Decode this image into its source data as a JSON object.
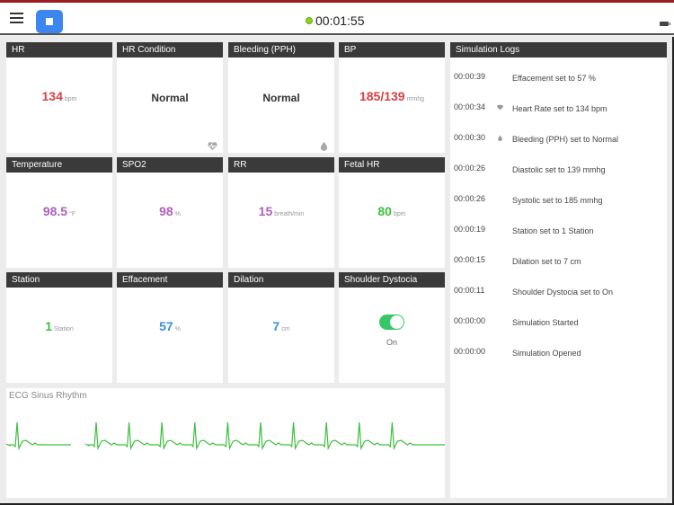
{
  "header": {
    "timer": "00:01:55",
    "status_color": "#8ed41c",
    "accent_color": "#3d86f0",
    "brand_bar_color": "#9b1c22"
  },
  "tiles": [
    {
      "id": "hr",
      "label": "HR",
      "value": "134",
      "unit": "bpm",
      "color": "red"
    },
    {
      "id": "hr-condition",
      "label": "HR Condition",
      "text": "Normal",
      "icon": "heart-pulse-icon"
    },
    {
      "id": "bleeding",
      "label": "Bleeding (PPH)",
      "text": "Normal",
      "icon": "drop-icon"
    },
    {
      "id": "bp",
      "label": "BP",
      "value": "185/139",
      "unit": "mmhg",
      "color": "red"
    },
    {
      "id": "temperature",
      "label": "Temperature",
      "value": "98.5",
      "unit": "°F",
      "color": "purple"
    },
    {
      "id": "spo2",
      "label": "SPO2",
      "value": "98",
      "unit": "%",
      "color": "purple"
    },
    {
      "id": "rr",
      "label": "RR",
      "value": "15",
      "unit": "breath/min",
      "color": "purple"
    },
    {
      "id": "fetal-hr",
      "label": "Fetal HR",
      "value": "80",
      "unit": "bpm",
      "color": "green"
    },
    {
      "id": "station",
      "label": "Station",
      "value": "1",
      "unit": "Station",
      "color": "green"
    },
    {
      "id": "effacement",
      "label": "Effacement",
      "value": "57",
      "unit": "%",
      "color": "blue"
    },
    {
      "id": "dilation",
      "label": "Dilation",
      "value": "7",
      "unit": "cm",
      "color": "blue"
    },
    {
      "id": "shoulder-dystocia",
      "label": "Shoulder Dystocia",
      "toggle": true,
      "toggle_state": "On"
    }
  ],
  "ecg": {
    "title": "ECG Sinus Rhythm",
    "line_color": "#3dbf3d"
  },
  "logs": {
    "title": "Simulation Logs",
    "entries": [
      {
        "time": "00:00:39",
        "icon": "",
        "message": "Effacement set to 57 %"
      },
      {
        "time": "00:00:34",
        "icon": "heart-icon",
        "message": "Heart Rate set to 134 bpm"
      },
      {
        "time": "00:00:30",
        "icon": "drop-icon",
        "message": "Bleeding (PPH) set to Normal"
      },
      {
        "time": "00:00:26",
        "icon": "",
        "message": "Diastolic set to 139 mmhg"
      },
      {
        "time": "00:00:26",
        "icon": "",
        "message": "Systolic set to 185 mmhg"
      },
      {
        "time": "00:00:19",
        "icon": "",
        "message": "Station set to 1 Station"
      },
      {
        "time": "00:00:15",
        "icon": "",
        "message": "Dilation set to 7 cm"
      },
      {
        "time": "00:00:11",
        "icon": "",
        "message": "Shoulder Dystocia set to On"
      },
      {
        "time": "00:00:00",
        "icon": "",
        "message": "Simulation Started"
      },
      {
        "time": "00:00:00",
        "icon": "",
        "message": "Simulation Opened"
      }
    ]
  }
}
